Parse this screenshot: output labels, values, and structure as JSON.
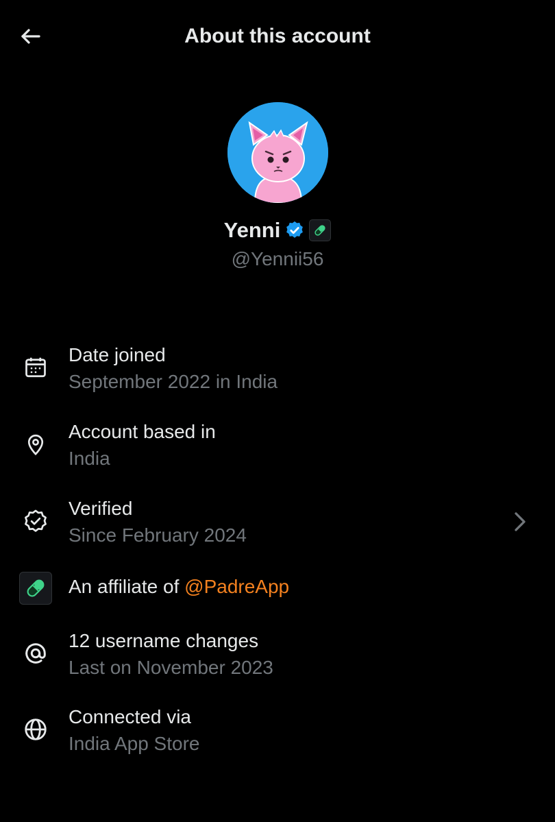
{
  "header": {
    "title": "About this account",
    "back_icon": "arrow-left-icon"
  },
  "profile": {
    "avatar_icon": "pink-cat-avatar",
    "name": "Yenni",
    "handle": "@Yennii56",
    "verified_icon": "blue-verified-check-icon",
    "affiliate_icon": "pill-affiliate-badge-icon"
  },
  "items": [
    {
      "icon": "calendar-icon",
      "title": "Date joined",
      "subtitle": "September 2022 in India"
    },
    {
      "icon": "location-pin-icon",
      "title": "Account based in",
      "subtitle": "India"
    },
    {
      "icon": "verified-badge-icon",
      "title": "Verified",
      "subtitle": "Since February 2024",
      "chevron": "chevron-right-icon"
    },
    {
      "icon": "pill-affiliate-icon",
      "title_prefix": "An affiliate of ",
      "title_mention": "@PadreApp"
    },
    {
      "icon": "at-sign-icon",
      "title": "12 username changes",
      "subtitle": "Last on November 2023"
    },
    {
      "icon": "globe-icon",
      "title": "Connected via",
      "subtitle": "India App Store"
    }
  ],
  "colors": {
    "background": "#000000",
    "primary_text": "#e7e9ea",
    "secondary_text": "#71767b",
    "verified_blue": "#1d9bf0",
    "mention_orange": "#f4811f",
    "avatar_bg": "#2aa3ec",
    "affiliate_green": "#3fd38a"
  }
}
